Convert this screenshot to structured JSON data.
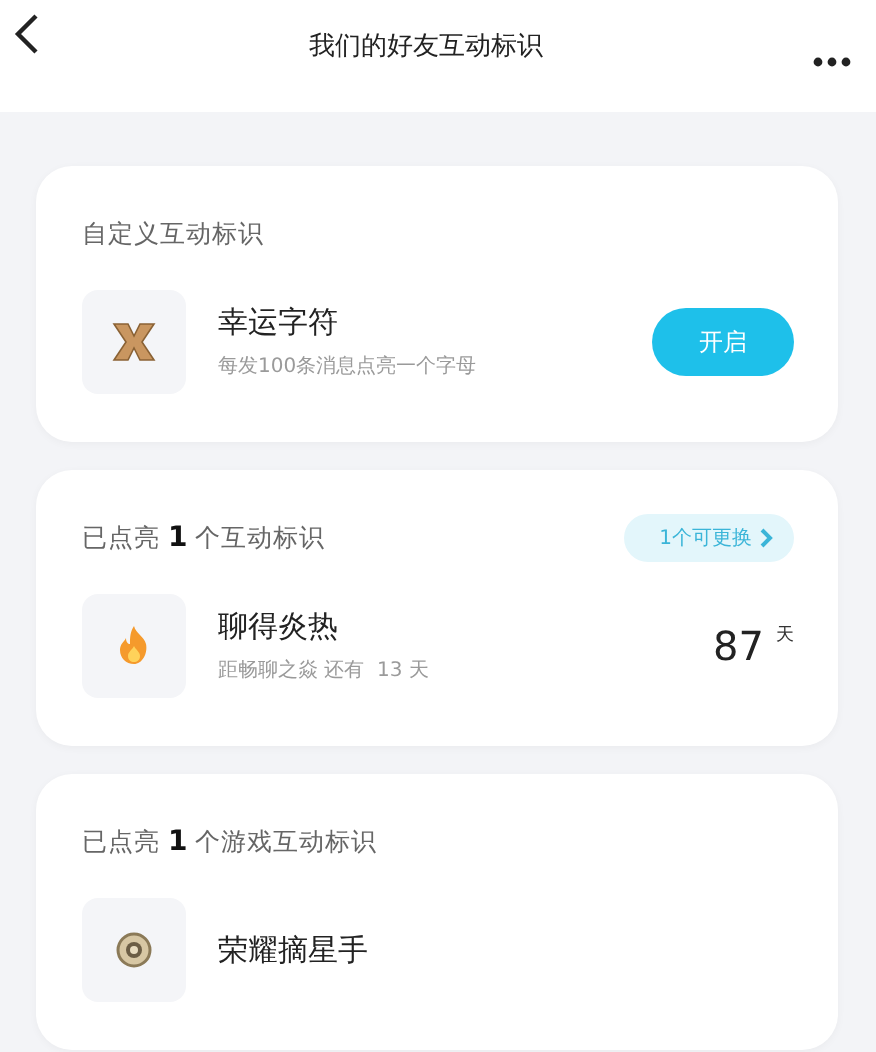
{
  "header": {
    "title": "我们的好友互动标识"
  },
  "cards": [
    {
      "heading": "自定义互动标识",
      "items": [
        {
          "kind": "letter",
          "name": "幸运字符",
          "desc": "每发100条消息点亮一个字母",
          "button": "开启"
        }
      ]
    },
    {
      "heading": "已点亮 **1** 个互动标识",
      "action": "1个可更换",
      "items": [
        {
          "kind": "flame",
          "name": "聊得炎热",
          "desc": "距畅聊之焱 还有  13 天",
          "value": "87",
          "unit": "天"
        }
      ]
    },
    {
      "heading": "已点亮 **1** 个游戏互动标识",
      "items": [
        {
          "kind": "medal",
          "name": "荣耀摘星手"
        }
      ]
    }
  ]
}
